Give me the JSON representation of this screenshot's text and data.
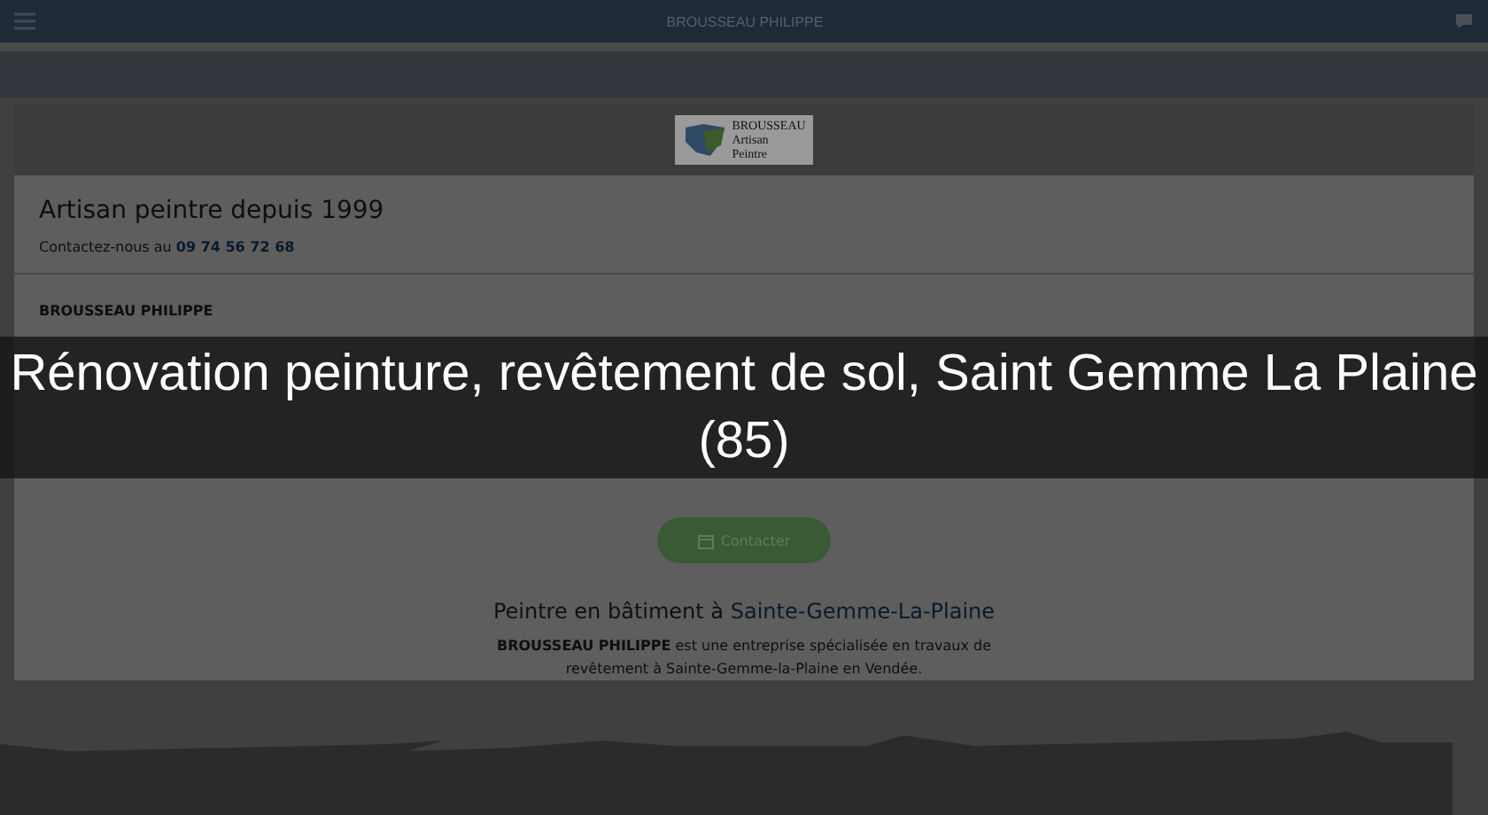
{
  "header": {
    "title": "BROUSSEAU PHILIPPE"
  },
  "logo": {
    "name": "BROUSSEAU",
    "line_1": "Artisan",
    "line_2": "Peintre"
  },
  "intro": {
    "heading": "Artisan peintre depuis 1999",
    "contact_text": "Contactez-nous au",
    "phone": "09 74 56 72 68"
  },
  "company": {
    "name": "BROUSSEAU PHILIPPE"
  },
  "contact_button": {
    "label": "Contacter"
  },
  "section": {
    "heading_start": "Peintre en bâtiment à ",
    "heading_link": "Sainte-Gemme-La-Plaine",
    "text": "**BROUSSEAU PHILIPPE** est une entreprise spécialisée en travaux de revêtement à Sainte-Gemme-la-Plaine en Vendée."
  },
  "overlay_title": "Rénovation peinture, revêtement de sol, Saint Gemme La Plaine (85)"
}
